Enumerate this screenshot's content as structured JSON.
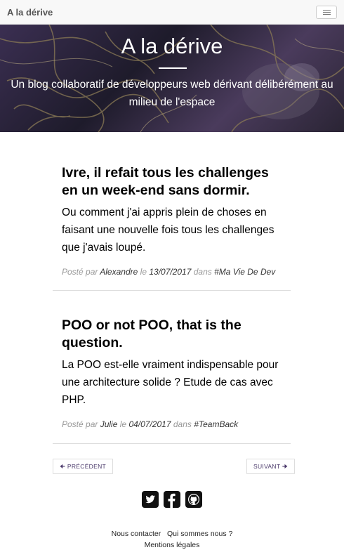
{
  "navbar": {
    "brand": "A la dérive",
    "toggle_icon": "hamburger-icon"
  },
  "hero": {
    "title": "A la dérive",
    "subtitle": "Un blog collaboratif de développeurs web dérivant délibérément au milieu de l'espace"
  },
  "posts": [
    {
      "title": "Ivre, il refait tous les challenges en un week-end sans dormir.",
      "subtitle": "Ou comment j'ai appris plein de choses en faisant une nouvelle fois tous les challenges que j'avais loupé.",
      "meta_posted_by": "Posté par",
      "author": "Alexandre",
      "meta_on": "le",
      "date": "13/07/2017",
      "meta_in": "dans",
      "category": "#Ma Vie De Dev"
    },
    {
      "title": "POO or not POO, that is the question.",
      "subtitle": "La POO est-elle vraiment indispensable pour une architecture solide ? Etude de cas avec PHP.",
      "meta_posted_by": "Posté par",
      "author": "Julie",
      "meta_on": "le",
      "date": "04/07/2017",
      "meta_in": "dans",
      "category": "#TeamBack"
    }
  ],
  "pager": {
    "prev_label": "PRÉCÉDENT",
    "prev_icon": "arrow-left-icon",
    "next_label": "SUIVANT",
    "next_icon": "arrow-right-icon"
  },
  "socials": [
    "twitter-icon",
    "facebook-icon",
    "github-icon"
  ],
  "footer": {
    "contact": "Nous contacter",
    "about": "Qui sommes nous ?",
    "legal": "Mentions légales"
  },
  "colors": {
    "accent": "#4b3a6b",
    "meta": "#999999"
  }
}
